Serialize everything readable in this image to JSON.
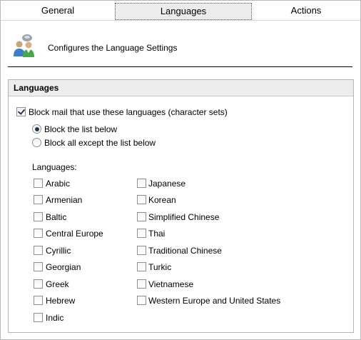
{
  "tabs": [
    {
      "label": "General",
      "active": false
    },
    {
      "label": "Languages",
      "active": true
    },
    {
      "label": "Actions",
      "active": false
    }
  ],
  "header": {
    "icon": "users-settings-icon",
    "description": "Configures the Language Settings"
  },
  "panel": {
    "title": "Languages",
    "block_mail": {
      "label": "Block mail that use these languages (character sets)",
      "checked": true
    },
    "mode_options": [
      {
        "label": "Block the list below",
        "selected": true
      },
      {
        "label": "Block all except the list below",
        "selected": false
      }
    ],
    "languages_label": "Languages:",
    "languages_left": [
      {
        "label": "Arabic",
        "checked": false
      },
      {
        "label": "Armenian",
        "checked": false
      },
      {
        "label": "Baltic",
        "checked": false
      },
      {
        "label": "Central Europe",
        "checked": false
      },
      {
        "label": "Cyrillic",
        "checked": false
      },
      {
        "label": "Georgian",
        "checked": false
      },
      {
        "label": "Greek",
        "checked": false
      },
      {
        "label": "Hebrew",
        "checked": false
      },
      {
        "label": "Indic",
        "checked": false
      }
    ],
    "languages_right": [
      {
        "label": "Japanese",
        "checked": false
      },
      {
        "label": "Korean",
        "checked": false
      },
      {
        "label": "Simplified Chinese",
        "checked": false
      },
      {
        "label": "Thai",
        "checked": false
      },
      {
        "label": "Traditional Chinese",
        "checked": false
      },
      {
        "label": "Turkic",
        "checked": false
      },
      {
        "label": "Vietnamese",
        "checked": false
      },
      {
        "label": "Western Europe and United States",
        "checked": false
      }
    ]
  },
  "colors": {
    "border": "#b4b4b4",
    "panel_title_bg": "#ededed",
    "check_mark": "#2d3a57"
  }
}
